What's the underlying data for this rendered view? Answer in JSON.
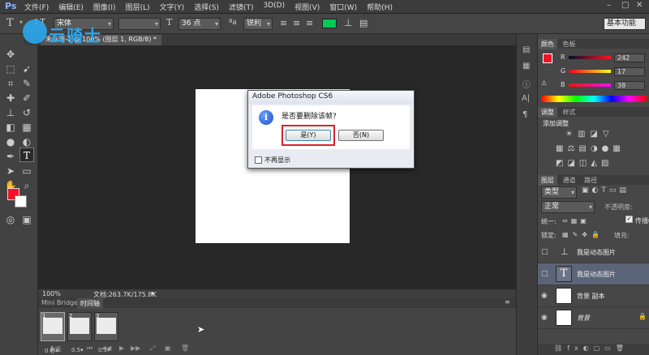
{
  "app": {
    "logo": "Ps"
  },
  "menu": [
    "文件(F)",
    "编辑(E)",
    "图像(I)",
    "图层(L)",
    "文字(Y)",
    "选择(S)",
    "滤镜(T)",
    "3D(D)",
    "视图(V)",
    "窗口(W)",
    "帮助(H)"
  ],
  "options": {
    "font_family": "宋体",
    "font_style": "",
    "size": "36 点",
    "aa_label": "ªa",
    "aa": "锐利",
    "color": "#00cc55"
  },
  "workspace": "基本功能",
  "document_tab": "未标题-1 @ 100% (图层 1, RGB/8) *",
  "watermark": "云骑士",
  "colors": {
    "fg": "#f21126",
    "bg": "#ffffff"
  },
  "status": {
    "zoom": "100%",
    "doc": "文档:263.7K/175.8K"
  },
  "timeline": {
    "tabs": [
      "Mini Bridge",
      "时间轴"
    ],
    "frames": [
      {
        "num": "1",
        "dur": "0 秒▾"
      },
      {
        "num": "2",
        "dur": "0.5▾"
      },
      {
        "num": "3",
        "dur": "0.5▾"
      }
    ],
    "loop": "永远"
  },
  "color_panel": {
    "tabs": [
      "颜色",
      "色板"
    ],
    "r_label": "R",
    "g_label": "G",
    "b_label": "B",
    "r": "242",
    "g": "17",
    "b": "38"
  },
  "adjust_panel": {
    "tabs": [
      "调整",
      "样式"
    ],
    "label": "添加调整"
  },
  "layers_panel": {
    "tabs": [
      "图层",
      "通道",
      "路径"
    ],
    "kind": "类型",
    "blend": "正常",
    "opacity_label": "不透明度:",
    "unify_label": "统一:",
    "propagate": "传播帧",
    "lock_label": "锁定:",
    "fill_label": "填充:",
    "layers": [
      {
        "name": "我是动态图片"
      },
      {
        "name": "我是动态图片"
      },
      {
        "name": "背景 副本"
      },
      {
        "name": "背景"
      }
    ]
  },
  "dialog": {
    "title": "Adobe Photoshop CS6",
    "message": "是否要删除该帧?",
    "yes": "是(Y)",
    "no": "否(N)",
    "dont_show": "不再显示"
  }
}
